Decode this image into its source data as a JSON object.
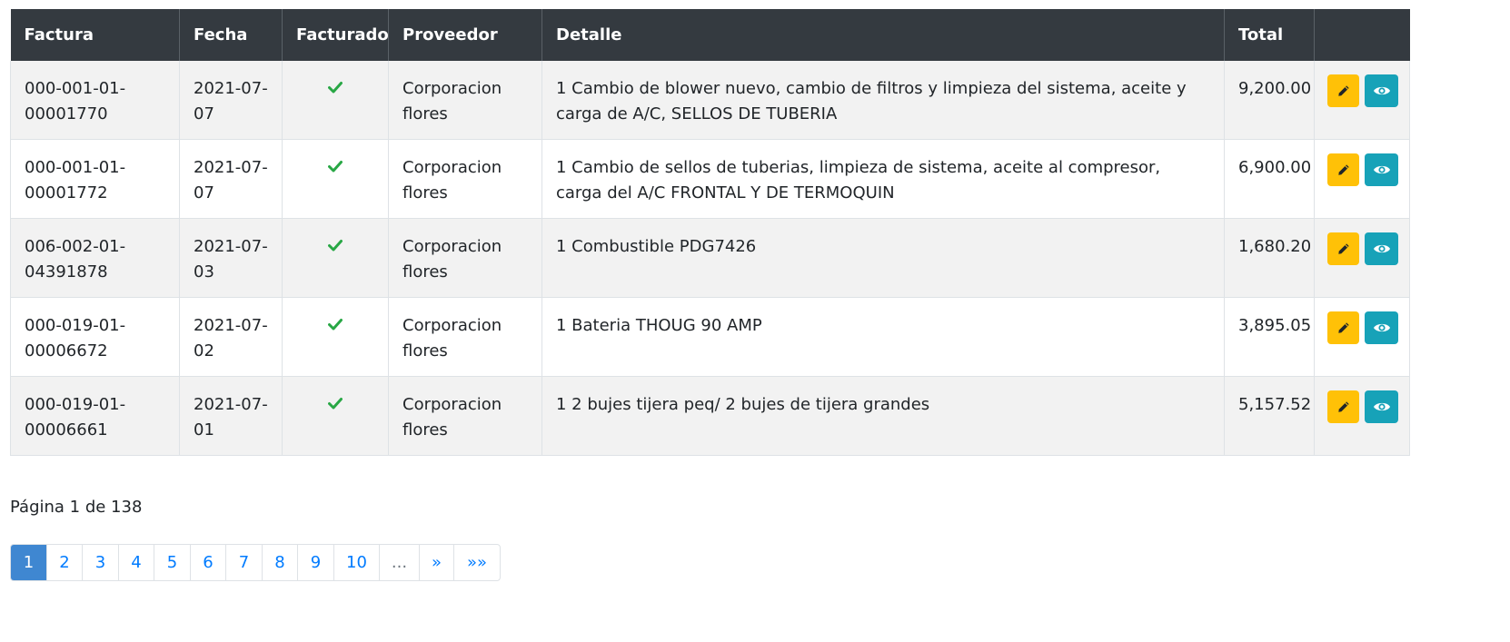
{
  "table": {
    "headers": [
      "Factura",
      "Fecha",
      "Facturado",
      "Proveedor",
      "Detalle",
      "Total",
      ""
    ],
    "rows": [
      {
        "factura": "000-001-01-00001770",
        "fecha": "2021-07-07",
        "facturado": true,
        "proveedor": "Corporacion flores",
        "detalle": "1 Cambio de blower nuevo, cambio de filtros y limpieza del sistema, aceite y carga de A/C, SELLOS DE TUBERIA",
        "total": "9,200.00"
      },
      {
        "factura": "000-001-01-00001772",
        "fecha": "2021-07-07",
        "facturado": true,
        "proveedor": "Corporacion flores",
        "detalle": "1 Cambio de sellos de tuberias, limpieza de sistema, aceite al compresor, carga del A/C FRONTAL Y DE TERMOQUIN",
        "total": "6,900.00"
      },
      {
        "factura": "006-002-01-04391878",
        "fecha": "2021-07-03",
        "facturado": true,
        "proveedor": "Corporacion flores",
        "detalle": "1 Combustible PDG7426",
        "total": "1,680.20"
      },
      {
        "factura": "000-019-01-00006672",
        "fecha": "2021-07-02",
        "facturado": true,
        "proveedor": "Corporacion flores",
        "detalle": "1 Bateria THOUG 90 AMP",
        "total": "3,895.05"
      },
      {
        "factura": "000-019-01-00006661",
        "fecha": "2021-07-01",
        "facturado": true,
        "proveedor": "Corporacion flores",
        "detalle": "1 2 bujes tijera peq/ 2 bujes de tijera grandes",
        "total": "5,157.52"
      }
    ]
  },
  "pagination": {
    "info": "Página 1 de 138",
    "pages": [
      {
        "label": "1",
        "active": true
      },
      {
        "label": "2"
      },
      {
        "label": "3"
      },
      {
        "label": "4"
      },
      {
        "label": "5"
      },
      {
        "label": "6"
      },
      {
        "label": "7"
      },
      {
        "label": "8"
      },
      {
        "label": "9"
      },
      {
        "label": "10"
      },
      {
        "label": "...",
        "disabled": true
      },
      {
        "label": "»"
      },
      {
        "label": "»»"
      }
    ]
  },
  "colors": {
    "header_bg": "#343a40",
    "check": "#28a745",
    "edit_button": "#ffc107",
    "view_button": "#17a2b8",
    "page_active": "#3f87d1",
    "link": "#007bff"
  },
  "icons": {
    "facturado": "check-icon",
    "edit": "pencil-icon",
    "view": "eye-icon"
  }
}
